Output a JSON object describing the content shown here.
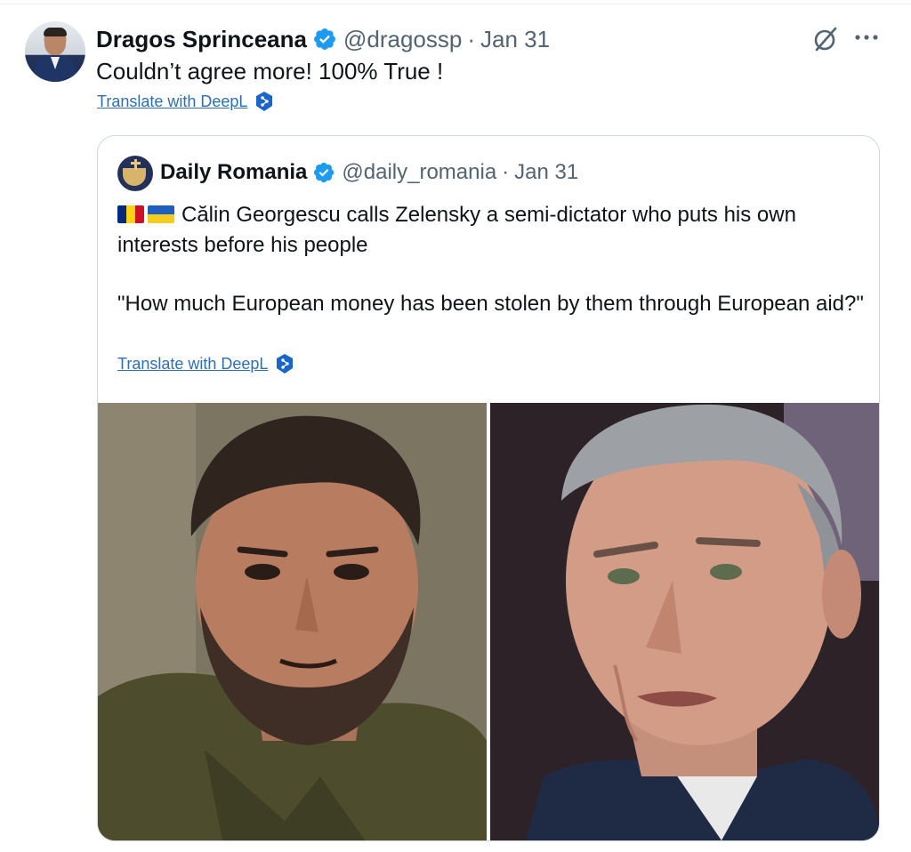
{
  "tweet": {
    "author_name": "Dragos Sprinceana",
    "handle": "@dragossp",
    "date": "Jan 31",
    "text": "Couldn’t agree more! 100% True !",
    "translate_label": "Translate with DeepL"
  },
  "quoted_tweet": {
    "author_name": "Daily Romania",
    "handle": "@daily_romania",
    "date": "Jan 31",
    "text_line1": "Călin Georgescu calls Zelensky a semi-dictator who puts his own interests before his people",
    "text_line2": "\"How much European money has been stolen by them through European aid?\"",
    "translate_label": "Translate with DeepL",
    "flags": [
      "romania-flag",
      "ukraine-flag"
    ]
  },
  "separator": "·",
  "colors": {
    "verified": "#1d9bf0",
    "secondary_text": "#536471",
    "link": "#2f6fb0",
    "deepl": "#1b64c8"
  },
  "icons": [
    "verified-badge-icon",
    "grok-icon",
    "more-icon",
    "deepl-icon"
  ]
}
